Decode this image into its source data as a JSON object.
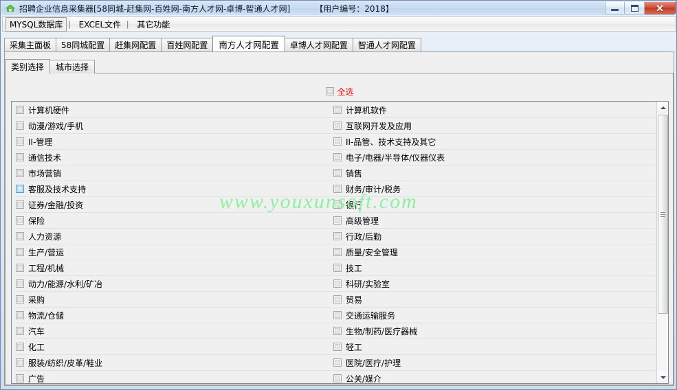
{
  "window": {
    "title": "招聘企业信息采集器[58同城-赶集网-百姓网-南方人才网-卓博-智通人才网]",
    "user_label": "【用户编号：2018】",
    "icon": "home-icon",
    "controls": {
      "minimize": "minimize-icon",
      "maximize": "maximize-icon",
      "close": "✕"
    }
  },
  "menu": {
    "items": [
      {
        "label": "MYSQL数据库",
        "active": true
      },
      {
        "label": "EXCEL文件",
        "active": false
      },
      {
        "label": "其它功能",
        "active": false
      }
    ],
    "separator": "|"
  },
  "tabs": {
    "items": [
      {
        "label": "采集主面板",
        "selected": false
      },
      {
        "label": "58同城配置",
        "selected": false
      },
      {
        "label": "赶集网配置",
        "selected": false
      },
      {
        "label": "百姓网配置",
        "selected": false
      },
      {
        "label": "南方人才网配置",
        "selected": true
      },
      {
        "label": "卓博人才网配置",
        "selected": false
      },
      {
        "label": "智通人才网配置",
        "selected": false
      }
    ]
  },
  "inner_tabs": {
    "items": [
      {
        "label": "类别选择",
        "selected": true
      },
      {
        "label": "城市选择",
        "selected": false
      }
    ]
  },
  "select_all": {
    "label": "全选",
    "checked": false,
    "color": "#ee0000"
  },
  "categories": {
    "left": [
      {
        "label": "计算机硬件",
        "checked": false,
        "hover": false
      },
      {
        "label": "动漫/游戏/手机",
        "checked": false,
        "hover": false
      },
      {
        "label": "II-管理",
        "checked": false,
        "hover": false
      },
      {
        "label": "通信技术",
        "checked": false,
        "hover": false
      },
      {
        "label": "市场营销",
        "checked": false,
        "hover": false
      },
      {
        "label": "客服及技术支持",
        "checked": false,
        "hover": true
      },
      {
        "label": "证券/金融/投资",
        "checked": false,
        "hover": false
      },
      {
        "label": "保险",
        "checked": false,
        "hover": false
      },
      {
        "label": "人力资源",
        "checked": false,
        "hover": false
      },
      {
        "label": "生产/营运",
        "checked": false,
        "hover": false
      },
      {
        "label": "工程/机械",
        "checked": false,
        "hover": false
      },
      {
        "label": "动力/能源/水利/矿冶",
        "checked": false,
        "hover": false
      },
      {
        "label": "采购",
        "checked": false,
        "hover": false
      },
      {
        "label": "物流/仓储",
        "checked": false,
        "hover": false
      },
      {
        "label": "汽车",
        "checked": false,
        "hover": false
      },
      {
        "label": "化工",
        "checked": false,
        "hover": false
      },
      {
        "label": "服装/纺织/皮革/鞋业",
        "checked": false,
        "hover": false
      },
      {
        "label": "广告",
        "checked": false,
        "hover": false
      }
    ],
    "right": [
      {
        "label": "计算机软件",
        "checked": false,
        "hover": false
      },
      {
        "label": "互联网开发及应用",
        "checked": false,
        "hover": false
      },
      {
        "label": "II-品管、技术支持及其它",
        "checked": false,
        "hover": false
      },
      {
        "label": "电子/电器/半导体/仪器仪表",
        "checked": false,
        "hover": false
      },
      {
        "label": "销售",
        "checked": false,
        "hover": false
      },
      {
        "label": "财务/审计/税务",
        "checked": false,
        "hover": false
      },
      {
        "label": "银行",
        "checked": false,
        "hover": false
      },
      {
        "label": "高级管理",
        "checked": false,
        "hover": false
      },
      {
        "label": "行政/后勤",
        "checked": false,
        "hover": false
      },
      {
        "label": "质量/安全管理",
        "checked": false,
        "hover": false
      },
      {
        "label": "技工",
        "checked": false,
        "hover": false
      },
      {
        "label": "科研/实验室",
        "checked": false,
        "hover": false
      },
      {
        "label": "贸易",
        "checked": false,
        "hover": false
      },
      {
        "label": "交通运输服务",
        "checked": false,
        "hover": false
      },
      {
        "label": "生物/制药/医疗器械",
        "checked": false,
        "hover": false
      },
      {
        "label": "轻工",
        "checked": false,
        "hover": false
      },
      {
        "label": "医院/医疗/护理",
        "checked": false,
        "hover": false
      },
      {
        "label": "公关/媒介",
        "checked": false,
        "hover": false
      }
    ]
  },
  "scrollbar": {
    "up_arrow": "arrow-up-icon",
    "down_arrow": "arrow-down-icon",
    "thumb": "scroll-thumb"
  },
  "watermark": {
    "text": "www.youxunsoft.com",
    "color": "#8ef0a0"
  }
}
